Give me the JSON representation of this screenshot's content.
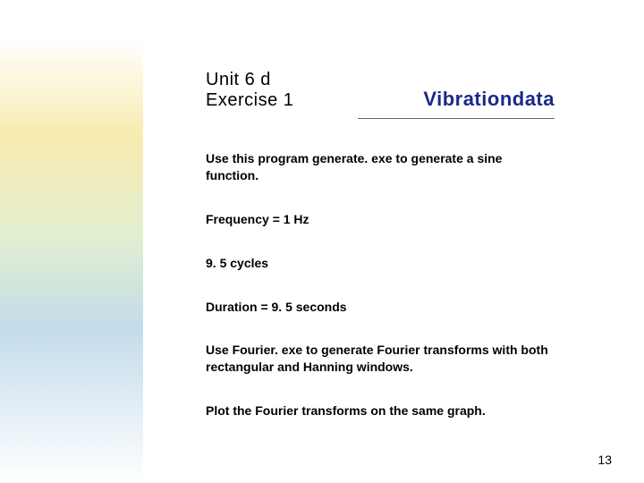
{
  "header": {
    "title_line1": "Unit 6 d",
    "title_line2": "Exercise 1",
    "brand": "Vibrationdata"
  },
  "body": {
    "p1": "Use this program generate. exe to generate a sine function.",
    "p2": "Frequency = 1 Hz",
    "p3": "9. 5 cycles",
    "p4": "Duration = 9. 5 seconds",
    "p5": "Use Fourier. exe to generate Fourier transforms with both rectangular and Hanning windows.",
    "p6": "Plot the Fourier transforms on the same graph."
  },
  "page_number": "13"
}
